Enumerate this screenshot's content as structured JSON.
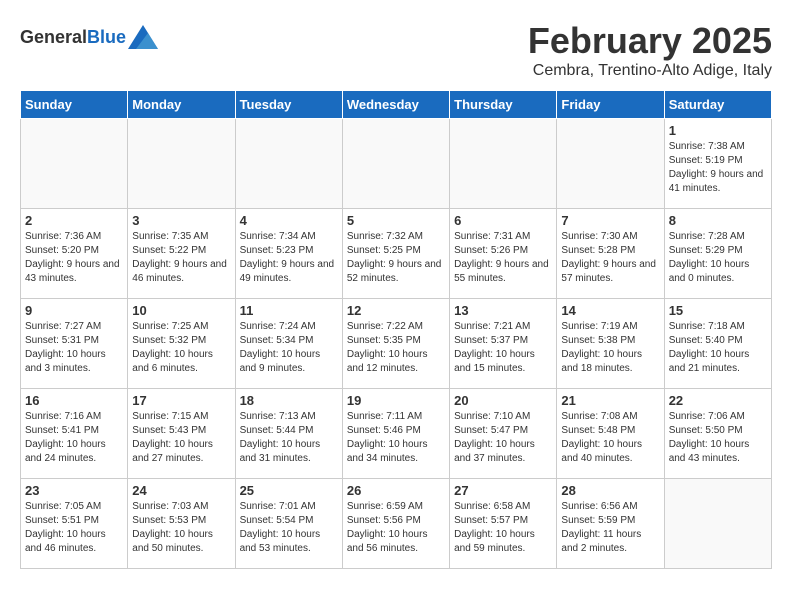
{
  "logo": {
    "general": "General",
    "blue": "Blue"
  },
  "title": "February 2025",
  "subtitle": "Cembra, Trentino-Alto Adige, Italy",
  "days_of_week": [
    "Sunday",
    "Monday",
    "Tuesday",
    "Wednesday",
    "Thursday",
    "Friday",
    "Saturday"
  ],
  "weeks": [
    [
      {
        "day": "",
        "info": ""
      },
      {
        "day": "",
        "info": ""
      },
      {
        "day": "",
        "info": ""
      },
      {
        "day": "",
        "info": ""
      },
      {
        "day": "",
        "info": ""
      },
      {
        "day": "",
        "info": ""
      },
      {
        "day": "1",
        "info": "Sunrise: 7:38 AM\nSunset: 5:19 PM\nDaylight: 9 hours and 41 minutes."
      }
    ],
    [
      {
        "day": "2",
        "info": "Sunrise: 7:36 AM\nSunset: 5:20 PM\nDaylight: 9 hours and 43 minutes."
      },
      {
        "day": "3",
        "info": "Sunrise: 7:35 AM\nSunset: 5:22 PM\nDaylight: 9 hours and 46 minutes."
      },
      {
        "day": "4",
        "info": "Sunrise: 7:34 AM\nSunset: 5:23 PM\nDaylight: 9 hours and 49 minutes."
      },
      {
        "day": "5",
        "info": "Sunrise: 7:32 AM\nSunset: 5:25 PM\nDaylight: 9 hours and 52 minutes."
      },
      {
        "day": "6",
        "info": "Sunrise: 7:31 AM\nSunset: 5:26 PM\nDaylight: 9 hours and 55 minutes."
      },
      {
        "day": "7",
        "info": "Sunrise: 7:30 AM\nSunset: 5:28 PM\nDaylight: 9 hours and 57 minutes."
      },
      {
        "day": "8",
        "info": "Sunrise: 7:28 AM\nSunset: 5:29 PM\nDaylight: 10 hours and 0 minutes."
      }
    ],
    [
      {
        "day": "9",
        "info": "Sunrise: 7:27 AM\nSunset: 5:31 PM\nDaylight: 10 hours and 3 minutes."
      },
      {
        "day": "10",
        "info": "Sunrise: 7:25 AM\nSunset: 5:32 PM\nDaylight: 10 hours and 6 minutes."
      },
      {
        "day": "11",
        "info": "Sunrise: 7:24 AM\nSunset: 5:34 PM\nDaylight: 10 hours and 9 minutes."
      },
      {
        "day": "12",
        "info": "Sunrise: 7:22 AM\nSunset: 5:35 PM\nDaylight: 10 hours and 12 minutes."
      },
      {
        "day": "13",
        "info": "Sunrise: 7:21 AM\nSunset: 5:37 PM\nDaylight: 10 hours and 15 minutes."
      },
      {
        "day": "14",
        "info": "Sunrise: 7:19 AM\nSunset: 5:38 PM\nDaylight: 10 hours and 18 minutes."
      },
      {
        "day": "15",
        "info": "Sunrise: 7:18 AM\nSunset: 5:40 PM\nDaylight: 10 hours and 21 minutes."
      }
    ],
    [
      {
        "day": "16",
        "info": "Sunrise: 7:16 AM\nSunset: 5:41 PM\nDaylight: 10 hours and 24 minutes."
      },
      {
        "day": "17",
        "info": "Sunrise: 7:15 AM\nSunset: 5:43 PM\nDaylight: 10 hours and 27 minutes."
      },
      {
        "day": "18",
        "info": "Sunrise: 7:13 AM\nSunset: 5:44 PM\nDaylight: 10 hours and 31 minutes."
      },
      {
        "day": "19",
        "info": "Sunrise: 7:11 AM\nSunset: 5:46 PM\nDaylight: 10 hours and 34 minutes."
      },
      {
        "day": "20",
        "info": "Sunrise: 7:10 AM\nSunset: 5:47 PM\nDaylight: 10 hours and 37 minutes."
      },
      {
        "day": "21",
        "info": "Sunrise: 7:08 AM\nSunset: 5:48 PM\nDaylight: 10 hours and 40 minutes."
      },
      {
        "day": "22",
        "info": "Sunrise: 7:06 AM\nSunset: 5:50 PM\nDaylight: 10 hours and 43 minutes."
      }
    ],
    [
      {
        "day": "23",
        "info": "Sunrise: 7:05 AM\nSunset: 5:51 PM\nDaylight: 10 hours and 46 minutes."
      },
      {
        "day": "24",
        "info": "Sunrise: 7:03 AM\nSunset: 5:53 PM\nDaylight: 10 hours and 50 minutes."
      },
      {
        "day": "25",
        "info": "Sunrise: 7:01 AM\nSunset: 5:54 PM\nDaylight: 10 hours and 53 minutes."
      },
      {
        "day": "26",
        "info": "Sunrise: 6:59 AM\nSunset: 5:56 PM\nDaylight: 10 hours and 56 minutes."
      },
      {
        "day": "27",
        "info": "Sunrise: 6:58 AM\nSunset: 5:57 PM\nDaylight: 10 hours and 59 minutes."
      },
      {
        "day": "28",
        "info": "Sunrise: 6:56 AM\nSunset: 5:59 PM\nDaylight: 11 hours and 2 minutes."
      },
      {
        "day": "",
        "info": ""
      }
    ]
  ]
}
